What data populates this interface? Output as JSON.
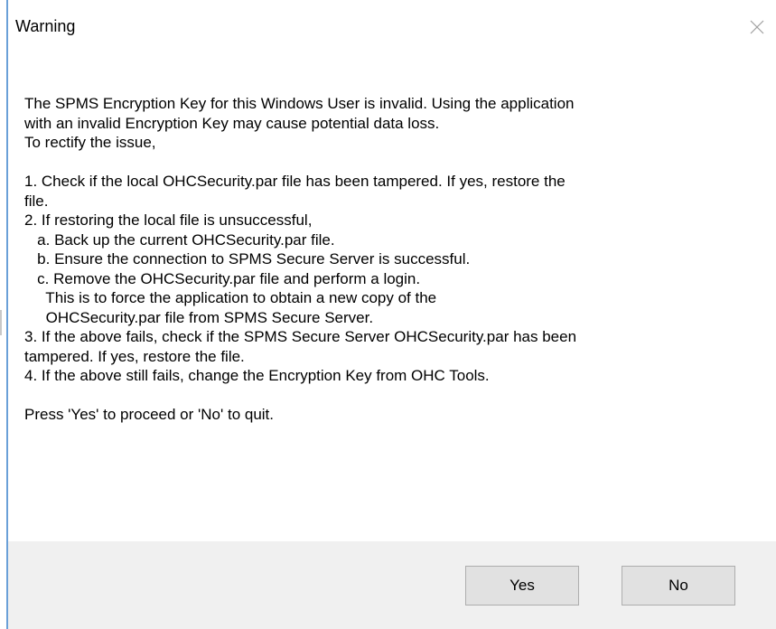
{
  "dialog": {
    "title": "Warning",
    "close_icon": "close-icon",
    "message_lines": [
      "The SPMS Encryption Key for this Windows User is invalid. Using the application",
      "with an invalid Encryption Key may cause potential data loss.",
      "To rectify the issue,",
      "",
      "1. Check if the local OHCSecurity.par file has been tampered. If yes, restore the",
      "file.",
      "2. If restoring the local file is unsuccessful,",
      "   a. Back up the current OHCSecurity.par file.",
      "   b. Ensure the connection to SPMS Secure Server is successful.",
      "   c. Remove the OHCSecurity.par file and perform a login.",
      "     This is to force the application to obtain a new copy of the",
      "     OHCSecurity.par file from SPMS Secure Server.",
      "3. If the above fails, check if the SPMS Secure Server OHCSecurity.par has been",
      "tampered. If yes, restore the file.",
      "4. If the above still fails, change the Encryption Key from OHC Tools.",
      "",
      "Press 'Yes' to proceed or 'No' to quit."
    ],
    "buttons": {
      "yes_label": "Yes",
      "no_label": "No"
    },
    "colors": {
      "accent_border": "#6aa0d8",
      "footer_bg": "#f0f0f0",
      "button_bg": "#e1e1e1"
    }
  }
}
